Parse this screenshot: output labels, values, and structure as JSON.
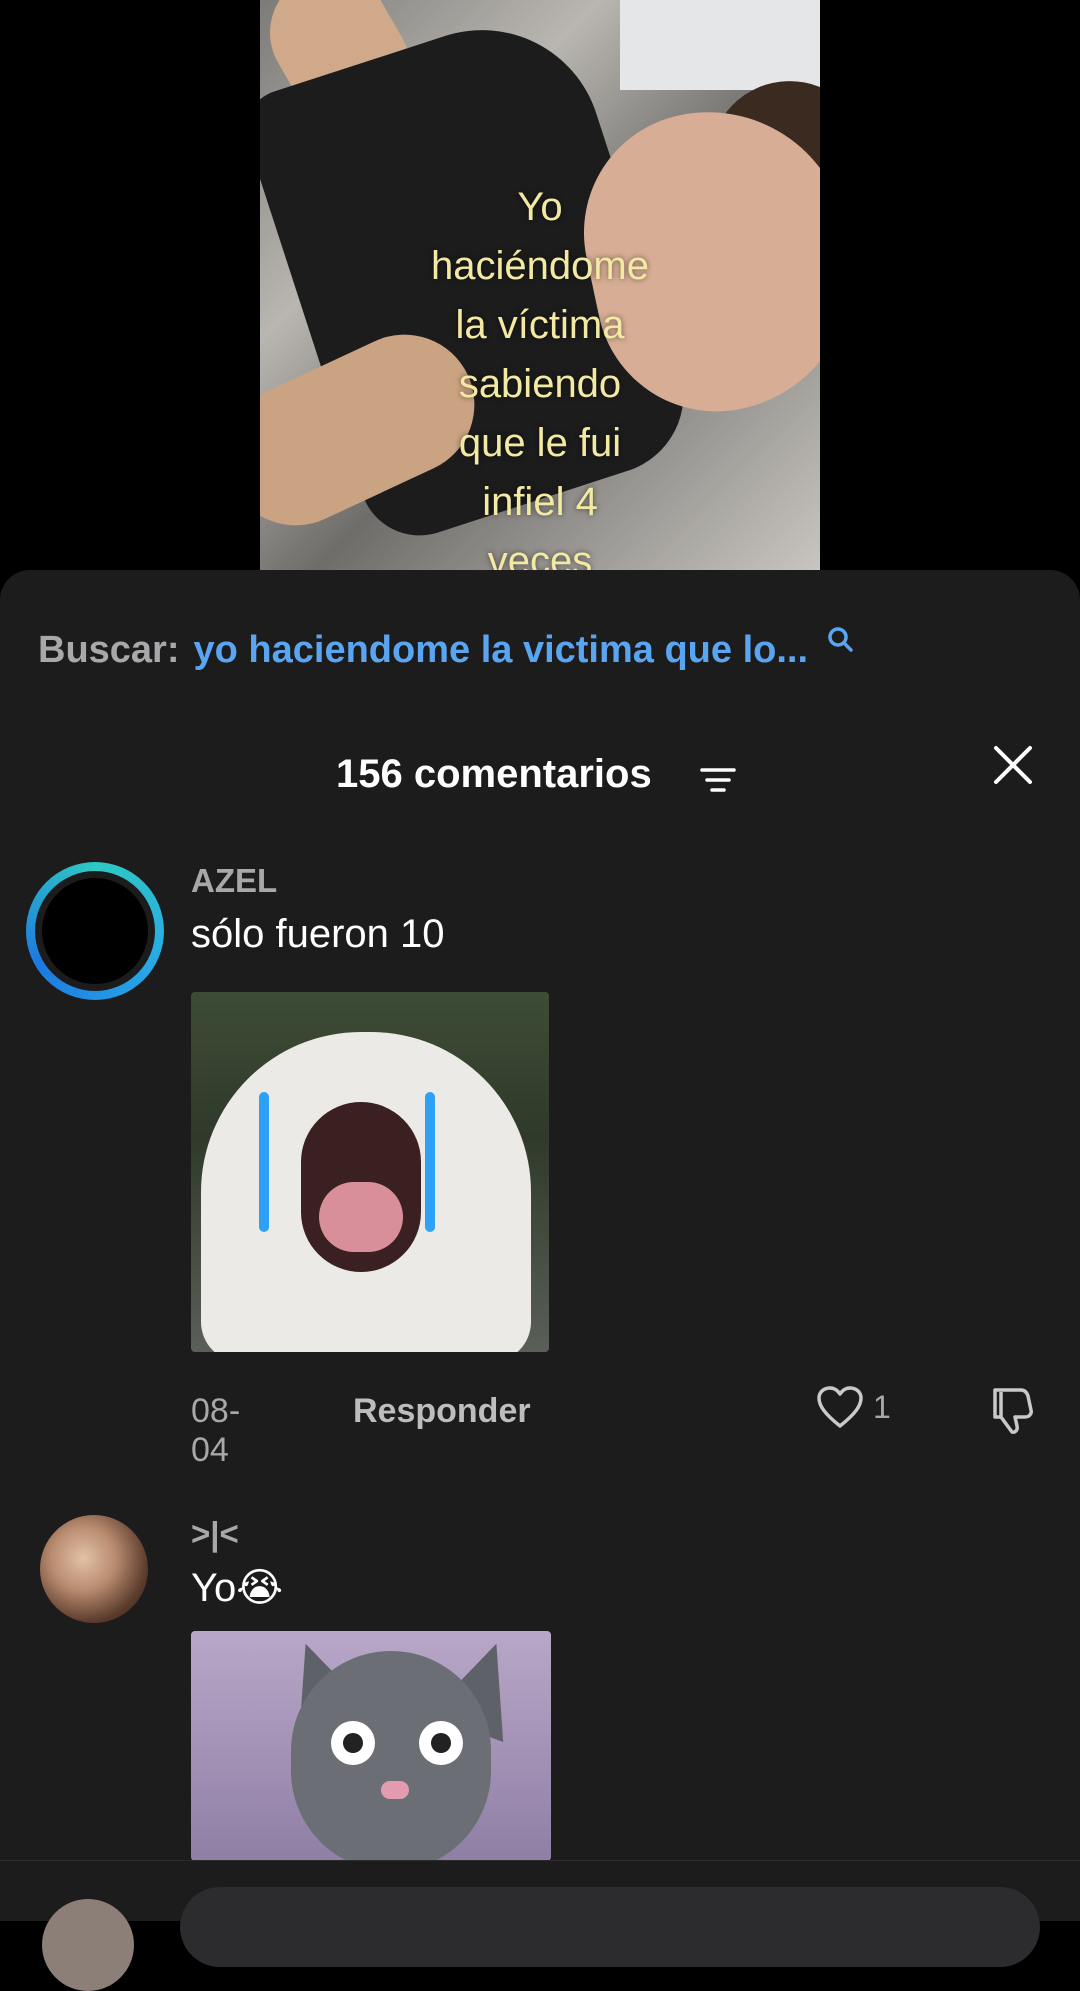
{
  "video": {
    "caption": "Yo\nhaciéndome\nla víctima\nsabiendo\nque le fui\ninfiel 4\nveces"
  },
  "search": {
    "label": "Buscar:",
    "query": "yo haciendome la victima que lo...",
    "icon": "search-icon"
  },
  "comments_header": {
    "count_label": "156 comentarios",
    "sort_icon": "filter-lines-icon",
    "close_icon": "close-icon"
  },
  "comments": [
    {
      "username": "AZEL",
      "text": "sólo fueron 10",
      "gif": "crying-dog-gif",
      "date": "08-04",
      "reply_label": "Responder",
      "likes": "1"
    },
    {
      "username": ">|<",
      "text": "Yo😭",
      "gif": "talking-cat-gif"
    }
  ],
  "colors": {
    "sheet_bg": "#1c1c1d",
    "search_query": "#5aa5f2",
    "muted": "#a8a8aa",
    "caption": "#f3e9a2"
  }
}
